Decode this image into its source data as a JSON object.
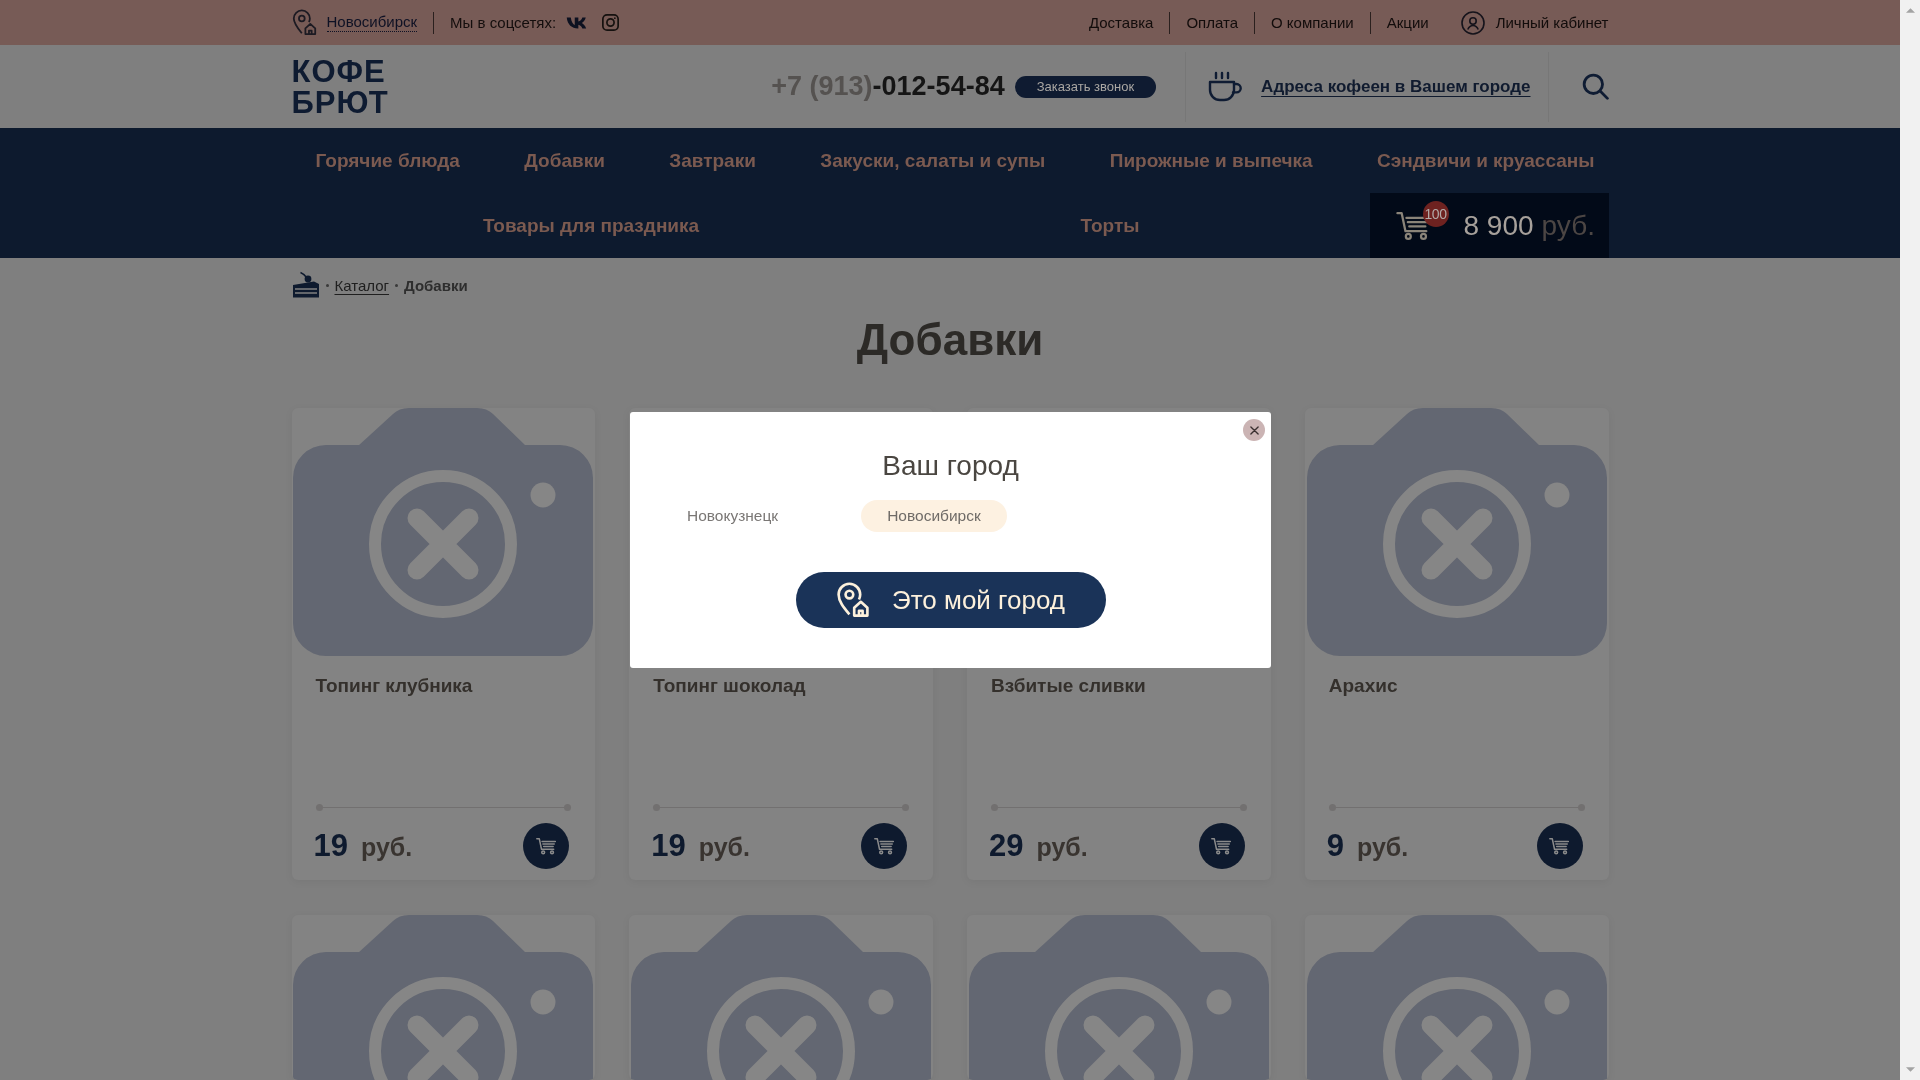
{
  "top_bar": {
    "city": "Новосибирск",
    "social_label": "Мы в соцсетях:",
    "links": [
      "Доставка",
      "Оплата",
      "О компании",
      "Акции"
    ],
    "account": "Личный кабинет"
  },
  "header": {
    "logo": [
      "КОФЕ",
      "БРЮТ"
    ],
    "phone": {
      "code": "+7 (913)",
      "number": "-012-54-84"
    },
    "callback_button": "Заказать звонок",
    "addresses_link": "Адреса кофеен в Вашем городе"
  },
  "nav": {
    "top_row": [
      "Горячие блюда",
      "Добавки",
      "Завтраки",
      "Закуски, салаты и супы",
      "Пирожные и выпечка",
      "Сэндвичи и круассаны"
    ],
    "bottom_row": [
      "Товары для праздника",
      "Торты"
    ],
    "cart": {
      "count": "100",
      "total": "8 900",
      "currency": "руб."
    }
  },
  "breadcrumbs": [
    {
      "label": "Каталог",
      "kind": "link"
    },
    {
      "label": "Добавки",
      "kind": "current"
    }
  ],
  "page_title": "Добавки",
  "products": [
    {
      "kind": "card",
      "name": "Топинг клубника",
      "price": "19",
      "currency": "руб."
    },
    {
      "kind": "covered",
      "name": "Топинг шоколад",
      "price": "19",
      "currency": "руб."
    },
    {
      "kind": "covered",
      "name": "Взбитые сливки",
      "price": "29",
      "currency": "руб."
    },
    {
      "kind": "card",
      "name": "Арахис",
      "price": "9",
      "currency": "руб."
    },
    {
      "kind": "cut_off"
    },
    {
      "kind": "cut_off"
    },
    {
      "kind": "cut_off"
    },
    {
      "kind": "cut_off"
    }
  ],
  "city_dialog": {
    "title": "Ваш город",
    "cities": [
      {
        "name": "Новокузнецк",
        "selected": false
      },
      {
        "name": "Новосибирск",
        "selected": true
      }
    ],
    "confirm_button": "Это мой город"
  }
}
